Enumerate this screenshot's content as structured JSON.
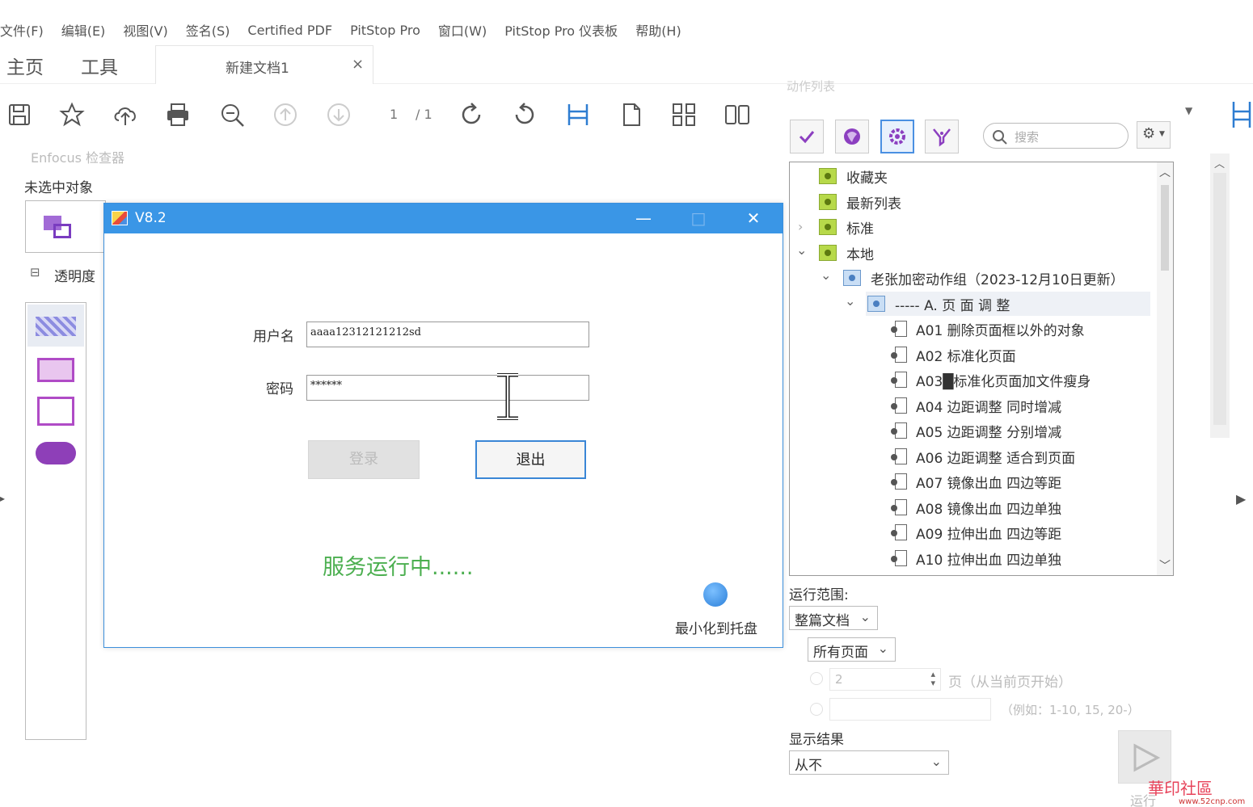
{
  "menubar": {
    "items": [
      "文件(F)",
      "编辑(E)",
      "视图(V)",
      "签名(S)",
      "Certified PDF",
      "PitStop Pro",
      "窗口(W)",
      "PitStop Pro 仪表板",
      "帮助(H)"
    ]
  },
  "tabs": {
    "home": "主页",
    "tools": "工具",
    "document": "新建文档1",
    "close": "×"
  },
  "toolbar": {
    "page_current": "1",
    "page_total": "/ 1"
  },
  "left_panel": {
    "title": "Enfocus 检查器",
    "selection": "未选中对象",
    "section": "透明度",
    "section_toggle": "⊟"
  },
  "dialog": {
    "title": "V8.2",
    "minimize": "—",
    "maximize": "□",
    "close": "✕",
    "username_label": "用户名",
    "username_value": "aaaa12312121212sd",
    "password_label": "密码",
    "password_value": "******",
    "login_button": "登录",
    "exit_button": "退出",
    "status": "服务运行中......",
    "tray_label": "最小化到托盘"
  },
  "actions_panel": {
    "title": "动作列表",
    "search_placeholder": "搜索",
    "tree": {
      "favorites": "收藏夹",
      "recent": "最新列表",
      "standard": "标准",
      "local": "本地",
      "group": "老张加密动作组（2023-12月10日更新）",
      "subgroup": "----- A. 页  面  调  整",
      "items": [
        "A01 删除页面框以外的对象",
        "A02 标准化页面",
        "A03█标准化页面加文件瘦身",
        "A04 边距调整 同时增减",
        "A05 边距调整 分别增减",
        "A06 边距调整 适合到页面",
        "A07 镜像出血 四边等距",
        "A08 镜像出血 四边单独",
        "A09 拉伸出血 四边等距",
        "A10 拉伸出血 四边单独"
      ]
    },
    "run_scope_label": "运行范围:",
    "scope_value": "整篇文档",
    "pages_value": "所有页面",
    "page_count_value": "2",
    "page_count_suffix": "页（从当前页开始）",
    "example_hint": "（例如：1-10, 15, 20-）",
    "show_result_label": "显示结果",
    "show_result_value": "从不",
    "run_label": "运行"
  },
  "watermark": {
    "text": "華印社區",
    "url": "www.52cnp.com"
  }
}
